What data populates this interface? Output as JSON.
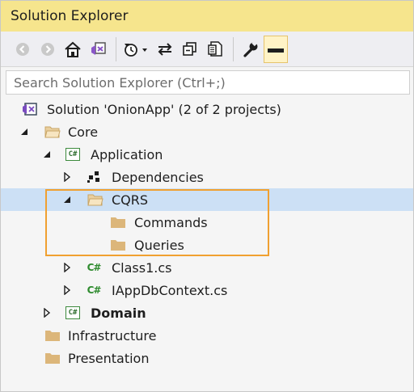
{
  "window": {
    "title": "Solution Explorer"
  },
  "toolbar": {
    "buttons": [
      {
        "icon": "back-icon"
      },
      {
        "icon": "forward-icon"
      },
      {
        "icon": "home-icon"
      },
      {
        "icon": "vs-switch-views-icon"
      },
      {
        "icon": "pending-changes-filter-icon"
      },
      {
        "icon": "sync-icon"
      },
      {
        "icon": "collapse-all-icon"
      },
      {
        "icon": "show-all-files-icon"
      },
      {
        "icon": "properties-wrench-icon"
      },
      {
        "icon": "preview-selected-icon"
      }
    ]
  },
  "search": {
    "placeholder": "Search Solution Explorer (Ctrl+;)"
  },
  "tree": {
    "solution": "Solution 'OnionApp' (2 of 2 projects)",
    "core": "Core",
    "application": "Application",
    "dependencies": "Dependencies",
    "cqrs": "CQRS",
    "commands": "Commands",
    "queries": "Queries",
    "class1": "Class1.cs",
    "iappdb": "IAppDbContext.cs",
    "domain": "Domain",
    "infrastructure": "Infrastructure",
    "presentation": "Presentation"
  },
  "icons": {
    "cs_project": "C#",
    "cs_file": "C#"
  },
  "colors": {
    "title_bar": "#f6e58d",
    "selection": "#cce0f5",
    "highlight_box": "#f0a030",
    "folder": "#dcb67a"
  }
}
